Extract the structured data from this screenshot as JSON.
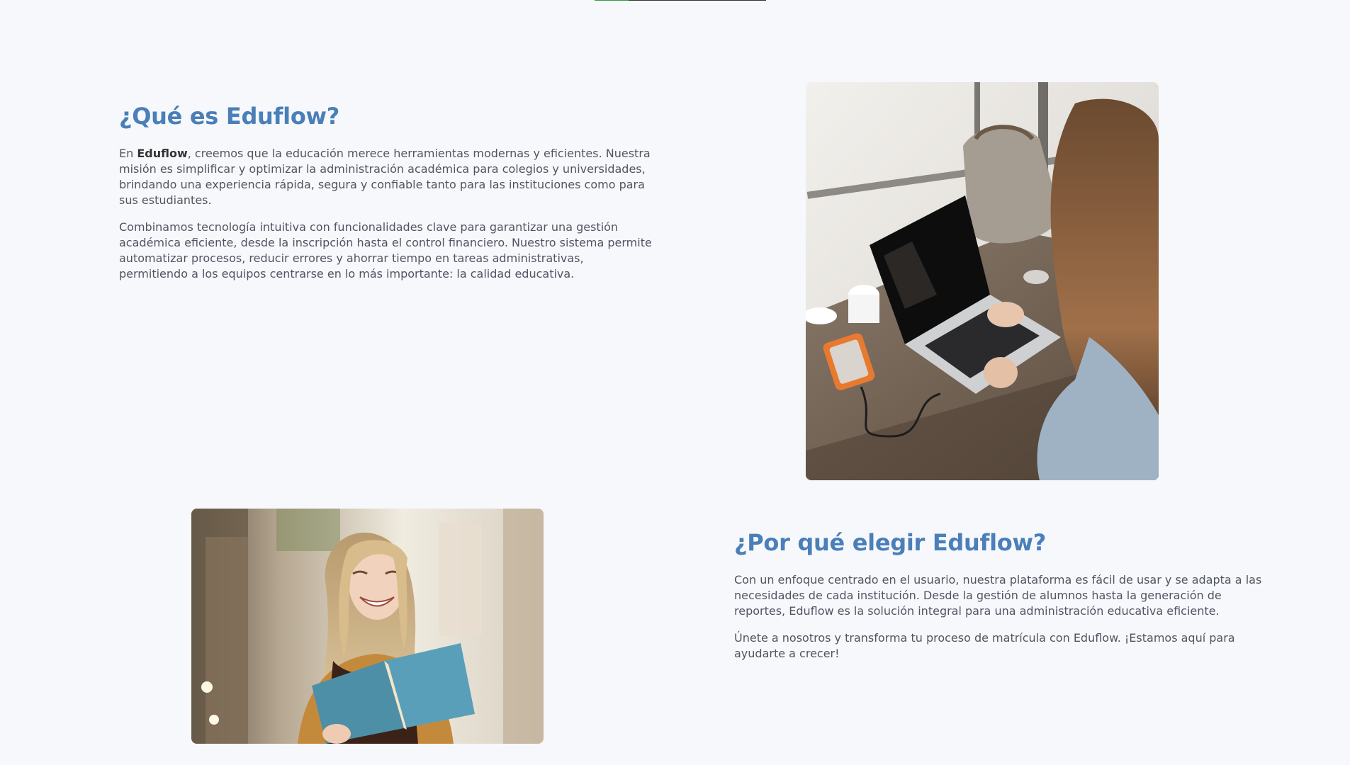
{
  "section_about": {
    "title": "¿Qué es Eduflow?",
    "p1_prefix": "En ",
    "p1_brand": "Eduflow",
    "p1_rest": ", creemos que la educación merece herramientas modernas y eficientes. Nuestra misión es simplificar y optimizar la administración académica para colegios y universidades, brindando una experiencia rápida, segura y confiable tanto para las instituciones como para sus estudiantes.",
    "p2": "Combinamos tecnología intuitiva con funcionalidades clave para garantizar una gestión académica eficiente, desde la inscripción hasta el control financiero. Nuestro sistema permite automatizar procesos, reducir errores y ahorrar tiempo en tareas administrativas, permitiendo a los equipos centrarse en lo más importante: la calidad educativa.",
    "image": "woman-working-on-laptop-photo"
  },
  "section_why": {
    "title": "¿Por qué elegir Eduflow?",
    "p1": "Con un enfoque centrado en el usuario, nuestra plataforma es fácil de usar y se adapta a las necesidades de cada institución. Desde la gestión de alumnos hasta la generación de reportes, Eduflow es la solución integral para una administración educativa eficiente.",
    "p2": "Únete a nosotros y transforma tu proceso de matrícula con Eduflow. ¡Estamos aquí para ayudarte a crecer!",
    "image": "smiling-student-with-book-photo"
  },
  "colors": {
    "heading": "#4a7fb8",
    "body_text": "#4f5560",
    "background": "#f7f8fc",
    "accent": "#2e9e44"
  }
}
